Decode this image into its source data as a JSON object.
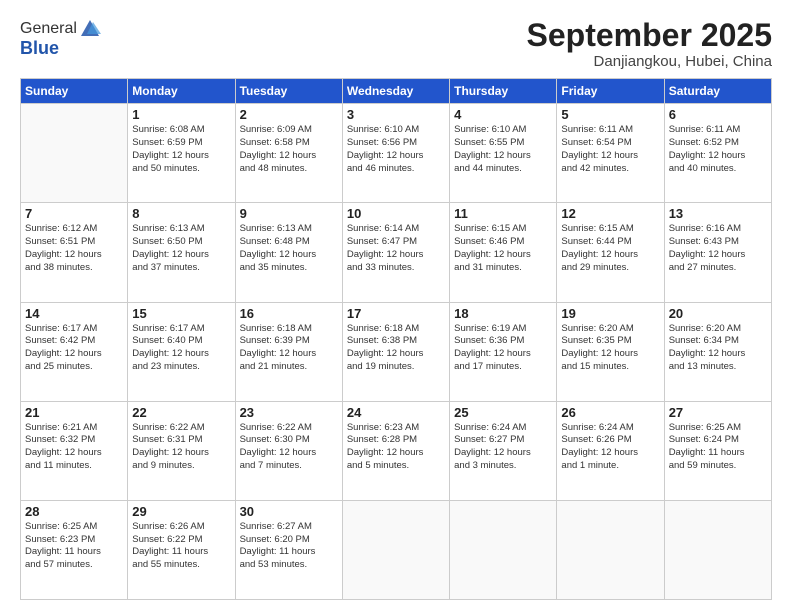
{
  "header": {
    "logo_line1": "General",
    "logo_line2": "Blue",
    "title": "September 2025",
    "location": "Danjiangkou, Hubei, China"
  },
  "days_of_week": [
    "Sunday",
    "Monday",
    "Tuesday",
    "Wednesday",
    "Thursday",
    "Friday",
    "Saturday"
  ],
  "weeks": [
    [
      {
        "day": "",
        "info": ""
      },
      {
        "day": "1",
        "info": "Sunrise: 6:08 AM\nSunset: 6:59 PM\nDaylight: 12 hours\nand 50 minutes."
      },
      {
        "day": "2",
        "info": "Sunrise: 6:09 AM\nSunset: 6:58 PM\nDaylight: 12 hours\nand 48 minutes."
      },
      {
        "day": "3",
        "info": "Sunrise: 6:10 AM\nSunset: 6:56 PM\nDaylight: 12 hours\nand 46 minutes."
      },
      {
        "day": "4",
        "info": "Sunrise: 6:10 AM\nSunset: 6:55 PM\nDaylight: 12 hours\nand 44 minutes."
      },
      {
        "day": "5",
        "info": "Sunrise: 6:11 AM\nSunset: 6:54 PM\nDaylight: 12 hours\nand 42 minutes."
      },
      {
        "day": "6",
        "info": "Sunrise: 6:11 AM\nSunset: 6:52 PM\nDaylight: 12 hours\nand 40 minutes."
      }
    ],
    [
      {
        "day": "7",
        "info": "Sunrise: 6:12 AM\nSunset: 6:51 PM\nDaylight: 12 hours\nand 38 minutes."
      },
      {
        "day": "8",
        "info": "Sunrise: 6:13 AM\nSunset: 6:50 PM\nDaylight: 12 hours\nand 37 minutes."
      },
      {
        "day": "9",
        "info": "Sunrise: 6:13 AM\nSunset: 6:48 PM\nDaylight: 12 hours\nand 35 minutes."
      },
      {
        "day": "10",
        "info": "Sunrise: 6:14 AM\nSunset: 6:47 PM\nDaylight: 12 hours\nand 33 minutes."
      },
      {
        "day": "11",
        "info": "Sunrise: 6:15 AM\nSunset: 6:46 PM\nDaylight: 12 hours\nand 31 minutes."
      },
      {
        "day": "12",
        "info": "Sunrise: 6:15 AM\nSunset: 6:44 PM\nDaylight: 12 hours\nand 29 minutes."
      },
      {
        "day": "13",
        "info": "Sunrise: 6:16 AM\nSunset: 6:43 PM\nDaylight: 12 hours\nand 27 minutes."
      }
    ],
    [
      {
        "day": "14",
        "info": "Sunrise: 6:17 AM\nSunset: 6:42 PM\nDaylight: 12 hours\nand 25 minutes."
      },
      {
        "day": "15",
        "info": "Sunrise: 6:17 AM\nSunset: 6:40 PM\nDaylight: 12 hours\nand 23 minutes."
      },
      {
        "day": "16",
        "info": "Sunrise: 6:18 AM\nSunset: 6:39 PM\nDaylight: 12 hours\nand 21 minutes."
      },
      {
        "day": "17",
        "info": "Sunrise: 6:18 AM\nSunset: 6:38 PM\nDaylight: 12 hours\nand 19 minutes."
      },
      {
        "day": "18",
        "info": "Sunrise: 6:19 AM\nSunset: 6:36 PM\nDaylight: 12 hours\nand 17 minutes."
      },
      {
        "day": "19",
        "info": "Sunrise: 6:20 AM\nSunset: 6:35 PM\nDaylight: 12 hours\nand 15 minutes."
      },
      {
        "day": "20",
        "info": "Sunrise: 6:20 AM\nSunset: 6:34 PM\nDaylight: 12 hours\nand 13 minutes."
      }
    ],
    [
      {
        "day": "21",
        "info": "Sunrise: 6:21 AM\nSunset: 6:32 PM\nDaylight: 12 hours\nand 11 minutes."
      },
      {
        "day": "22",
        "info": "Sunrise: 6:22 AM\nSunset: 6:31 PM\nDaylight: 12 hours\nand 9 minutes."
      },
      {
        "day": "23",
        "info": "Sunrise: 6:22 AM\nSunset: 6:30 PM\nDaylight: 12 hours\nand 7 minutes."
      },
      {
        "day": "24",
        "info": "Sunrise: 6:23 AM\nSunset: 6:28 PM\nDaylight: 12 hours\nand 5 minutes."
      },
      {
        "day": "25",
        "info": "Sunrise: 6:24 AM\nSunset: 6:27 PM\nDaylight: 12 hours\nand 3 minutes."
      },
      {
        "day": "26",
        "info": "Sunrise: 6:24 AM\nSunset: 6:26 PM\nDaylight: 12 hours\nand 1 minute."
      },
      {
        "day": "27",
        "info": "Sunrise: 6:25 AM\nSunset: 6:24 PM\nDaylight: 11 hours\nand 59 minutes."
      }
    ],
    [
      {
        "day": "28",
        "info": "Sunrise: 6:25 AM\nSunset: 6:23 PM\nDaylight: 11 hours\nand 57 minutes."
      },
      {
        "day": "29",
        "info": "Sunrise: 6:26 AM\nSunset: 6:22 PM\nDaylight: 11 hours\nand 55 minutes."
      },
      {
        "day": "30",
        "info": "Sunrise: 6:27 AM\nSunset: 6:20 PM\nDaylight: 11 hours\nand 53 minutes."
      },
      {
        "day": "",
        "info": ""
      },
      {
        "day": "",
        "info": ""
      },
      {
        "day": "",
        "info": ""
      },
      {
        "day": "",
        "info": ""
      }
    ]
  ]
}
